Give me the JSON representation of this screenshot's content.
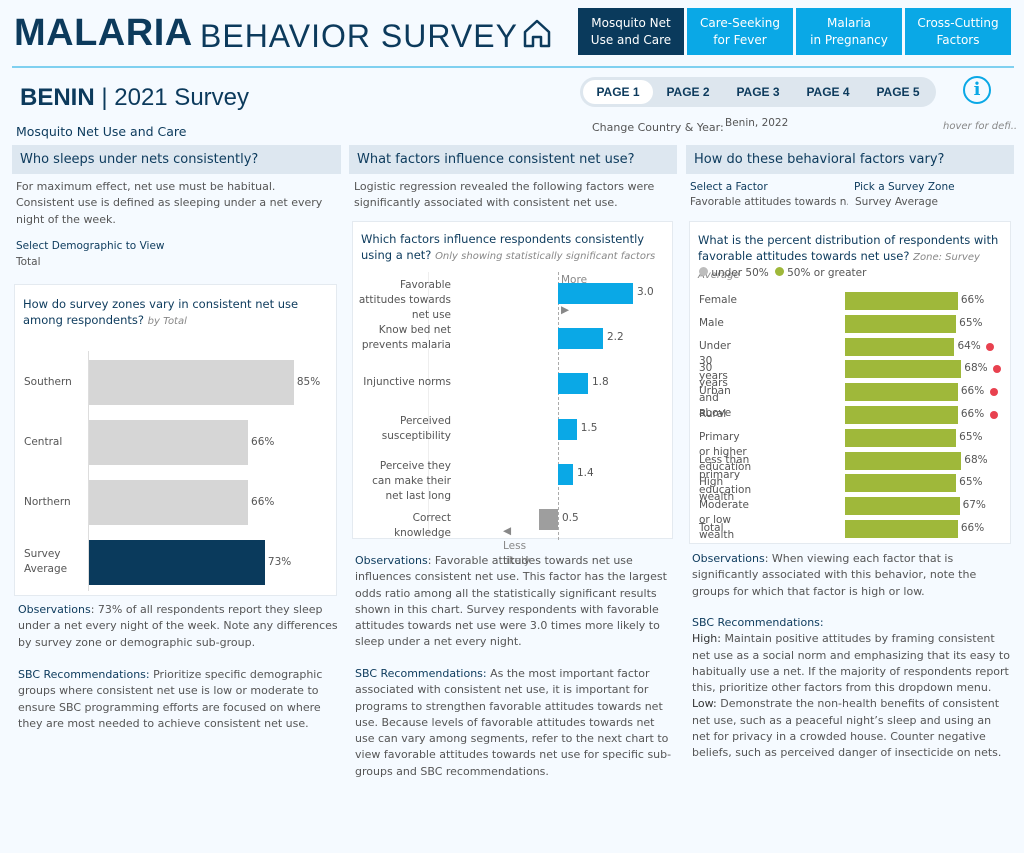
{
  "header": {
    "title_bold": "MALARIA",
    "title_light": "BEHAVIOR SURVEY",
    "home_icon": "home-icon",
    "nav": [
      {
        "label": "Mosquito Net\nUse and Care",
        "active": true
      },
      {
        "label": "Care-Seeking\nfor Fever"
      },
      {
        "label": "Malaria\nin Pregnancy"
      },
      {
        "label": "Cross-Cutting\nFactors"
      }
    ]
  },
  "country": {
    "name": "BENIN",
    "sep": "|",
    "survey": "2021 Survey"
  },
  "pages": [
    "PAGE 1",
    "PAGE 2",
    "PAGE 3",
    "PAGE 4",
    "PAGE 5"
  ],
  "active_page": "PAGE 1",
  "info_icon": "i",
  "subtitle": "Mosquito Net Use and Care",
  "change_label": "Change Country & Year:",
  "change_value": "Benin, 2022",
  "hover_hint": "hover for defi..",
  "col1": {
    "heading": "Who sleeps under nets consistently?",
    "intro": "For maximum effect, net use must be habitual. Consistent use is defined as sleeping under a net every night of the week.",
    "select_label": "Select Demographic to View",
    "select_value": "Total",
    "chart_title": "How do survey zones vary in consistent net use among respondents?",
    "chart_sub": "by Total",
    "obs_label": "Observations",
    "obs_text": ": 73% of all respondents report they sleep under a net every night of the week. Note any differences by survey zone or demographic sub-group.",
    "sbc_label": "SBC Recommendations:",
    "sbc_text": " Prioritize specific demographic groups where consistent net use is low or moderate to ensure SBC programming efforts are focused on where they are most needed to achieve consistent net use."
  },
  "col2": {
    "heading": "What factors influence consistent net use?",
    "intro": "Logistic regression revealed the following factors were significantly associated with consistent net use.",
    "chart_title": "Which factors influence respondents consistently using a net?",
    "chart_sub": "Only showing statistically significant factors",
    "more": "More likely ▶",
    "less": "◀ Less likely",
    "obs_label": "Observations",
    "obs_text": ": Favorable attitudes towards net use influences consistent net use. This factor has the largest odds ratio among all the statistically significant results shown in this chart. Survey respondents with favorable attitudes towards net use were 3.0 times more likely to sleep under a net every night.",
    "sbc_label": "SBC Recommendations:",
    "sbc_text": " As the most important factor associated with consistent net use, it is important for programs to strengthen favorable attitudes towards net use. Because levels of favorable attitudes towards net use can vary among segments, refer to the next chart to view favorable attitudes towards net use for specific sub-groups and SBC recommendations."
  },
  "col3": {
    "heading": "How do these behavioral factors vary?",
    "factor_label": "Select a Factor",
    "factor_value": "Favorable attitudes towards n..",
    "zone_label": "Pick a Survey Zone",
    "zone_value": "Survey Average",
    "chart_title": "What is the percent distribution of respondents with favorable attitudes towards net use?",
    "chart_sub": "Zone: Survey Average",
    "legend": [
      {
        "label": "under 50%",
        "color": "#bdbdbd"
      },
      {
        "label": "50% or greater",
        "color": "#9fb83a"
      }
    ],
    "obs_label": "Observations",
    "obs_text": ": When viewing each factor that is significantly associated with this behavior, note the groups for which that factor is high or low.",
    "sbc_label": "SBC Recommendations:",
    "high_label": "High:",
    "high_text": " Maintain positive attitudes by framing consistent net use as a social norm and emphasizing that its easy to habitually use a net. If the majority of respondents report this, prioritize other factors from this dropdown menu.",
    "low_label": "Low:",
    "low_text": " Demonstrate the non-health benefits of consistent net use, such as a peaceful night’s sleep and using an net for privacy in a crowded house. Counter negative beliefs, such as perceived danger of insecticide on nets."
  },
  "colors": {
    "navy": "#0a3a5c",
    "accent": "#0aa8e6",
    "grey_bar": "#d6d6d6",
    "green": "#9fb83a",
    "red_dot": "#e8414f",
    "grey_neg": "#9e9e9e"
  },
  "chart_data": [
    {
      "type": "bar",
      "orientation": "horizontal",
      "categories": [
        "Southern",
        "Central",
        "Northern",
        "Survey Average"
      ],
      "values": [
        85,
        66,
        66,
        73
      ],
      "labels": [
        "85%",
        "66%",
        "66%",
        "73%"
      ],
      "unit": "%",
      "xlim": [
        0,
        100
      ],
      "highlight": "Survey Average"
    },
    {
      "type": "bar",
      "orientation": "horizontal",
      "categories": [
        "Favorable attitudes towards net use",
        "Know bed net prevents malaria",
        "Injunctive norms",
        "Perceived susceptibility",
        "Perceive they can make their net last long",
        "Correct knowledge"
      ],
      "values": [
        3.0,
        2.2,
        1.8,
        1.5,
        1.4,
        0.5
      ],
      "labels": [
        "3.0",
        "2.2",
        "1.8",
        "1.5",
        "1.4",
        "0.5"
      ],
      "baseline": 1,
      "measure": "odds ratio"
    },
    {
      "type": "bar",
      "orientation": "horizontal",
      "categories": [
        "Female",
        "Male",
        "Under 30 years",
        "30 years and above",
        "Urban",
        "Rural",
        "Primary or higher education",
        "Less than primary education",
        "High wealth",
        "Moderate or low wealth",
        "Total"
      ],
      "values": [
        66,
        65,
        64,
        68,
        66,
        66,
        65,
        68,
        65,
        67,
        66
      ],
      "labels": [
        "66%",
        "65%",
        "64%",
        "68%",
        "66%",
        "66%",
        "65%",
        "68%",
        "65%",
        "67%",
        "66%"
      ],
      "flagged": [
        false,
        false,
        true,
        true,
        true,
        true,
        false,
        false,
        false,
        false,
        false
      ],
      "xlim": [
        0,
        100
      ]
    }
  ]
}
